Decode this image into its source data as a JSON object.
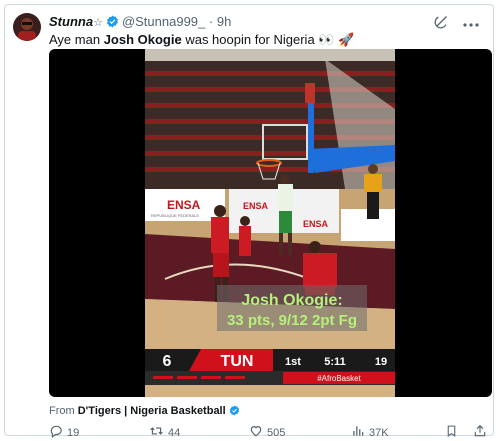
{
  "tweet": {
    "author_name": "Stunna",
    "author_star": "☆",
    "handle": "@Stunna999_",
    "separator": "·",
    "time": "9h",
    "text_before": "Aye man ",
    "text_bold": "Josh Okogie",
    "text_after": " was hoopin for Nigeria ",
    "emoji": "👀 🚀",
    "icons": [
      "grok-icon",
      "more-options-icon"
    ]
  },
  "video": {
    "overlay_line1": "Josh Okogie:",
    "overlay_line2": "33 pts, 9/12 2pt Fg",
    "sponsor": "ENSA",
    "sponsor_sub": "REPUBLIQUE FEDERALE",
    "scoreboard": {
      "home_score": "6",
      "team": "TUN",
      "quarter": "1st",
      "clock": "5:11",
      "shot_clock": "19",
      "hashtag": "#AfroBasket"
    },
    "colors": {
      "overlay_text": "#b5f17a",
      "scoreboard_red": "#d0111b",
      "overlay_bg": "rgba(110,110,110,0.55)"
    }
  },
  "attribution": {
    "prefix": "From ",
    "source": "D'Tigers | Nigeria Basketball"
  },
  "actions": {
    "replies": "19",
    "retweets": "44",
    "likes": "505",
    "views": "37K"
  }
}
